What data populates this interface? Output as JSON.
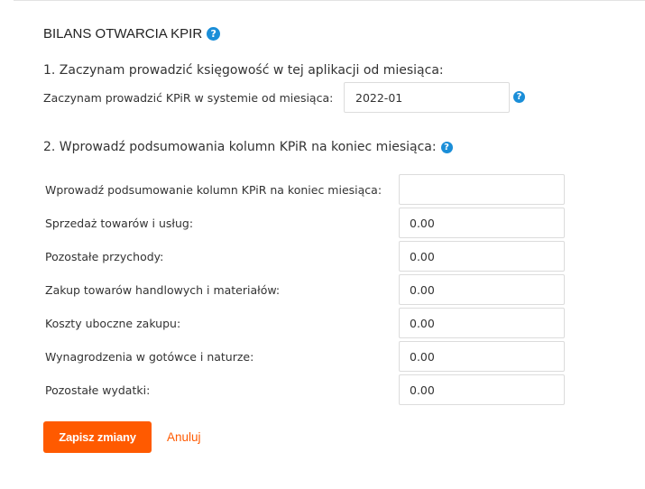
{
  "title": "BILANS OTWARCIA KPIR",
  "help_icon_glyph": "?",
  "colors": {
    "accent": "#ff5a00",
    "help_icon": "#1a8ed8"
  },
  "section1": {
    "heading": "1. Zaczynam prowadzić księgowość w tej aplikacji od miesiąca:",
    "start_label": "Zaczynam prowadzić KPiR w systemie od miesiąca:",
    "start_value": "2022-01"
  },
  "section2": {
    "heading": "2. Wprowadź podsumowania kolumn KPiR na koniec miesiąca:",
    "rows": [
      {
        "label": "Wprowadź podsumowanie kolumn KPiR na koniec miesiąca:",
        "value": ""
      },
      {
        "label": "Sprzedaż towarów i usług:",
        "value": "0.00"
      },
      {
        "label": "Pozostałe przychody:",
        "value": "0.00"
      },
      {
        "label": "Zakup towarów handlowych i materiałów:",
        "value": "0.00"
      },
      {
        "label": "Koszty uboczne zakupu:",
        "value": "0.00"
      },
      {
        "label": "Wynagrodzenia w gotówce i naturze:",
        "value": "0.00"
      },
      {
        "label": "Pozostałe wydatki:",
        "value": "0.00"
      }
    ]
  },
  "actions": {
    "save_label": "Zapisz zmiany",
    "cancel_label": "Anuluj"
  }
}
